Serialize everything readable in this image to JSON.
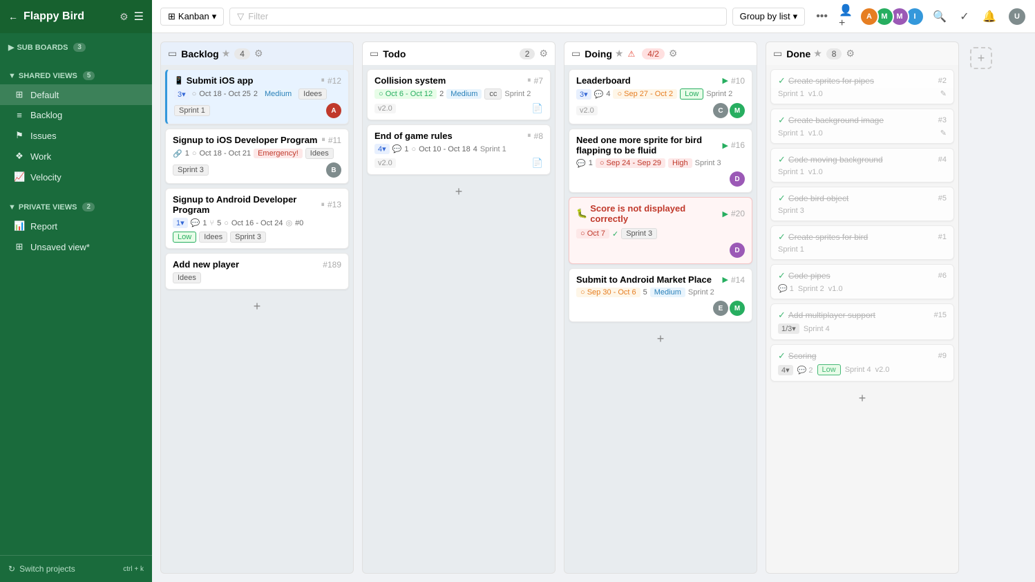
{
  "app": {
    "name": "Flappy Bird",
    "gear_icon": "⚙",
    "menu_icon": "☰",
    "back_icon": "←"
  },
  "sidebar": {
    "sub_boards_label": "SUB BOARDS",
    "sub_boards_count": "3",
    "shared_views_label": "SHARED VIEWS",
    "shared_views_count": "5",
    "private_views_label": "PRIVATE VIEWS",
    "private_views_count": "2",
    "items": [
      {
        "id": "default",
        "label": "Default",
        "icon": "⊞",
        "active": true
      },
      {
        "id": "backlog",
        "label": "Backlog",
        "icon": "≡"
      },
      {
        "id": "issues",
        "label": "Issues",
        "icon": "⚑"
      },
      {
        "id": "work",
        "label": "Work",
        "icon": "❖"
      },
      {
        "id": "velocity",
        "label": "Velocity",
        "icon": "📈"
      },
      {
        "id": "report",
        "label": "Report",
        "icon": "📊"
      },
      {
        "id": "unsaved",
        "label": "Unsaved view*",
        "icon": "⊞"
      }
    ],
    "switch_projects": "Switch projects",
    "switch_shortcut": "ctrl + k"
  },
  "topbar": {
    "kanban_label": "Kanban",
    "filter_placeholder": "Filter",
    "group_by_label": "Group by list",
    "more_icon": "•••"
  },
  "columns": [
    {
      "id": "backlog",
      "title": "Backlog",
      "count": "4",
      "has_star": true,
      "cards": [
        {
          "id": "c1",
          "title": "Submit iOS app",
          "num": "#12",
          "highlighted": true,
          "meta_pill": "3▾",
          "date": "Oct 18 - Oct 25",
          "date_style": "normal",
          "count2": "2",
          "tag": "Medium",
          "tag_style": "medium",
          "extra_tag": "Idees",
          "sprint": "Sprint 1",
          "has_pause": true,
          "has_avatar": true,
          "avatar_color": "#c0392b",
          "avatar_letter": "A"
        },
        {
          "id": "c2",
          "title": "Signup to iOS Developer Program",
          "num": "#11",
          "date": "Oct 18 - Oct 21",
          "date_style": "normal",
          "comment_count": "1",
          "tag": "Emergency!",
          "tag_style": "emergency",
          "extra_tag": "Idees",
          "sprint": "Sprint 3",
          "has_pause": true,
          "has_avatar": true,
          "avatar_color": "#7f8c8d",
          "avatar_letter": "B"
        },
        {
          "id": "c3",
          "title": "Signup to Android Developer Program",
          "num": "#13",
          "meta_pill": "1▾",
          "comment_count": "1",
          "subtask_count": "5",
          "date": "Oct 16 - Oct 24",
          "date_style": "normal",
          "zero_tag": "#0",
          "tag": "Low",
          "tag_style": "low",
          "extra_tag": "Idees",
          "sprint": "Sprint 3",
          "has_pause": true
        },
        {
          "id": "c4",
          "title": "Add new player",
          "num": "#189",
          "extra_tag": "Idees"
        }
      ]
    },
    {
      "id": "todo",
      "title": "Todo",
      "count": "2",
      "has_star": false,
      "cards": [
        {
          "id": "t1",
          "title": "Collision system",
          "num": "#7",
          "date": "Oct 6 - Oct 12",
          "date_style": "green",
          "count2": "2",
          "tag": "Medium",
          "tag_style": "medium",
          "extra_tag": "cc",
          "sprint": "Sprint 2",
          "has_pause": true,
          "version": "v2.0",
          "has_doc_icon": true
        },
        {
          "id": "t2",
          "title": "End of game rules",
          "num": "#8",
          "meta_pill": "4▾",
          "comment_count": "1",
          "date": "Oct 10 - Oct 18",
          "date_style": "normal",
          "count2": "4",
          "sprint": "Sprint 1",
          "has_pause": true,
          "version": "v2.0",
          "has_doc_icon": true
        }
      ]
    },
    {
      "id": "doing",
      "title": "Doing",
      "count": "4/2",
      "count_warning": true,
      "has_star": true,
      "cards": [
        {
          "id": "d1",
          "title": "Leaderboard",
          "num": "#10",
          "meta_pill": "3▾",
          "comment_count": "4",
          "date": "Sep 27 - Oct 2",
          "date_style": "orange",
          "tag": "Low",
          "tag_style": "low",
          "sprint": "Sprint 2",
          "has_play": true,
          "version": "v2.0",
          "has_avatar": true,
          "avatar_color": "#7f8c8d",
          "avatar_letter": "C",
          "avatar2_color": "#27ae60",
          "avatar2_letter": "M"
        },
        {
          "id": "d2",
          "title": "Need one more sprite for bird flapping to be fluid",
          "num": "#16",
          "comment_count": "1",
          "date": "Sep 24 - Sep 29",
          "date_style": "red",
          "tag": "High",
          "tag_style": "high",
          "sprint": "Sprint 3",
          "has_play": true,
          "has_avatar": true,
          "avatar_color": "#9b59b6",
          "avatar_letter": "D"
        },
        {
          "id": "d3",
          "title": "Score is not displayed correctly",
          "num": "#20",
          "highlighted_red": true,
          "date": "Oct 7",
          "date_style": "red",
          "sprint": "Sprint 3",
          "has_play": true,
          "has_check": true,
          "is_bug": true,
          "has_avatar": true,
          "avatar_color": "#9b59b6",
          "avatar_letter": "D"
        },
        {
          "id": "d4",
          "title": "Submit to Android Market Place",
          "num": "#14",
          "date": "Sep 30 - Oct 6",
          "date_style": "orange",
          "count2": "5",
          "tag": "Medium",
          "tag_style": "medium",
          "sprint": "Sprint 2",
          "has_play": true,
          "has_avatar": true,
          "avatar_color": "#7f8c8d",
          "avatar_letter": "E",
          "avatar2_color": "#27ae60",
          "avatar2_letter": "M"
        }
      ]
    },
    {
      "id": "done",
      "title": "Done",
      "count": "8",
      "has_star": true,
      "cards": [
        {
          "id": "dn1",
          "title": "Create sprites for pipes",
          "num": "#2",
          "sprint": "Sprint 1",
          "version": "v1.0",
          "done": true,
          "has_check": true
        },
        {
          "id": "dn2",
          "title": "Create background image",
          "num": "#3",
          "sprint": "Sprint 1",
          "version": "v1.0",
          "done": true,
          "has_check": true,
          "has_edit": true
        },
        {
          "id": "dn3",
          "title": "Code moving background",
          "num": "#4",
          "sprint": "Sprint 1",
          "version": "v1.0",
          "done": true,
          "has_check": true
        },
        {
          "id": "dn4",
          "title": "Code bird object",
          "num": "#5",
          "sprint": "Sprint 3",
          "done": true,
          "has_check": true
        },
        {
          "id": "dn5",
          "title": "Create sprites for bird",
          "num": "#1",
          "sprint": "Sprint 1",
          "done": true,
          "has_check": true
        },
        {
          "id": "dn6",
          "title": "Code pipes",
          "num": "#6",
          "comment_count": "1",
          "sprint": "Sprint 2",
          "version": "v1.0",
          "done": true,
          "has_check": true
        },
        {
          "id": "dn7",
          "title": "Add multiplayer support",
          "num": "#15",
          "meta_pill": "1/3▾",
          "sprint": "Sprint 4",
          "done": true,
          "has_check": true
        },
        {
          "id": "dn8",
          "title": "Scoring",
          "num": "#9",
          "meta_pill": "4▾",
          "comment_count": "2",
          "tag": "Low",
          "tag_style": "low",
          "sprint": "Sprint 4",
          "version": "v2.0",
          "done": true,
          "has_check": true
        }
      ]
    }
  ]
}
